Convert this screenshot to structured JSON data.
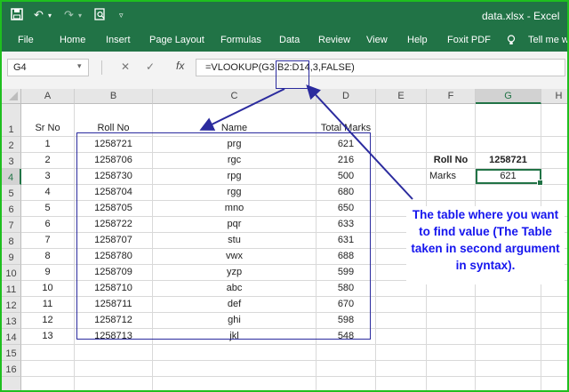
{
  "window": {
    "title": "data.xlsx - Excel"
  },
  "ribbon": {
    "tabs": [
      "File",
      "Home",
      "Insert",
      "Page Layout",
      "Formulas",
      "Data",
      "Review",
      "View",
      "Help",
      "Foxit PDF",
      "Tell me wh"
    ]
  },
  "formula_bar": {
    "name_box": "G4",
    "formula": "=VLOOKUP(G3,B2:D14,3,FALSE)",
    "fx_label": "fx",
    "cancel": "✕",
    "enter": "✓"
  },
  "columns": [
    "A",
    "B",
    "C",
    "D",
    "E",
    "F",
    "G",
    "H"
  ],
  "selected_column": "G",
  "selected_row": 4,
  "rows": [
    "1",
    "2",
    "3",
    "4",
    "5",
    "6",
    "7",
    "8",
    "9",
    "10",
    "11",
    "12",
    "13",
    "14",
    "15",
    "16"
  ],
  "table": {
    "headers": [
      "Sr No",
      "Roll No",
      "Name",
      "Total Marks"
    ],
    "records": [
      [
        "1",
        "1258721",
        "prg",
        "621"
      ],
      [
        "2",
        "1258706",
        "rgc",
        "216"
      ],
      [
        "3",
        "1258730",
        "rpg",
        "500"
      ],
      [
        "4",
        "1258704",
        "rgg",
        "680"
      ],
      [
        "5",
        "1258705",
        "mno",
        "650"
      ],
      [
        "6",
        "1258722",
        "pqr",
        "633"
      ],
      [
        "7",
        "1258707",
        "stu",
        "631"
      ],
      [
        "8",
        "1258780",
        "vwx",
        "688"
      ],
      [
        "9",
        "1258709",
        "yzp",
        "599"
      ],
      [
        "10",
        "1258710",
        "abc",
        "580"
      ],
      [
        "11",
        "1258711",
        "def",
        "670"
      ],
      [
        "12",
        "1258712",
        "ghi",
        "598"
      ],
      [
        "13",
        "1258713",
        "jkl",
        "548"
      ]
    ]
  },
  "lookup": {
    "roll_label": "Roll No",
    "roll_value": "1258721",
    "marks_label": "Marks",
    "marks_value": "621"
  },
  "annotation": {
    "text": "The table where you want to find value (The Table taken in second argument in syntax)."
  },
  "colors": {
    "excel_green": "#217346",
    "annotation_blue": "#1515ee",
    "box_navy": "#2b2b9e",
    "frame": "#1fbf1f"
  }
}
